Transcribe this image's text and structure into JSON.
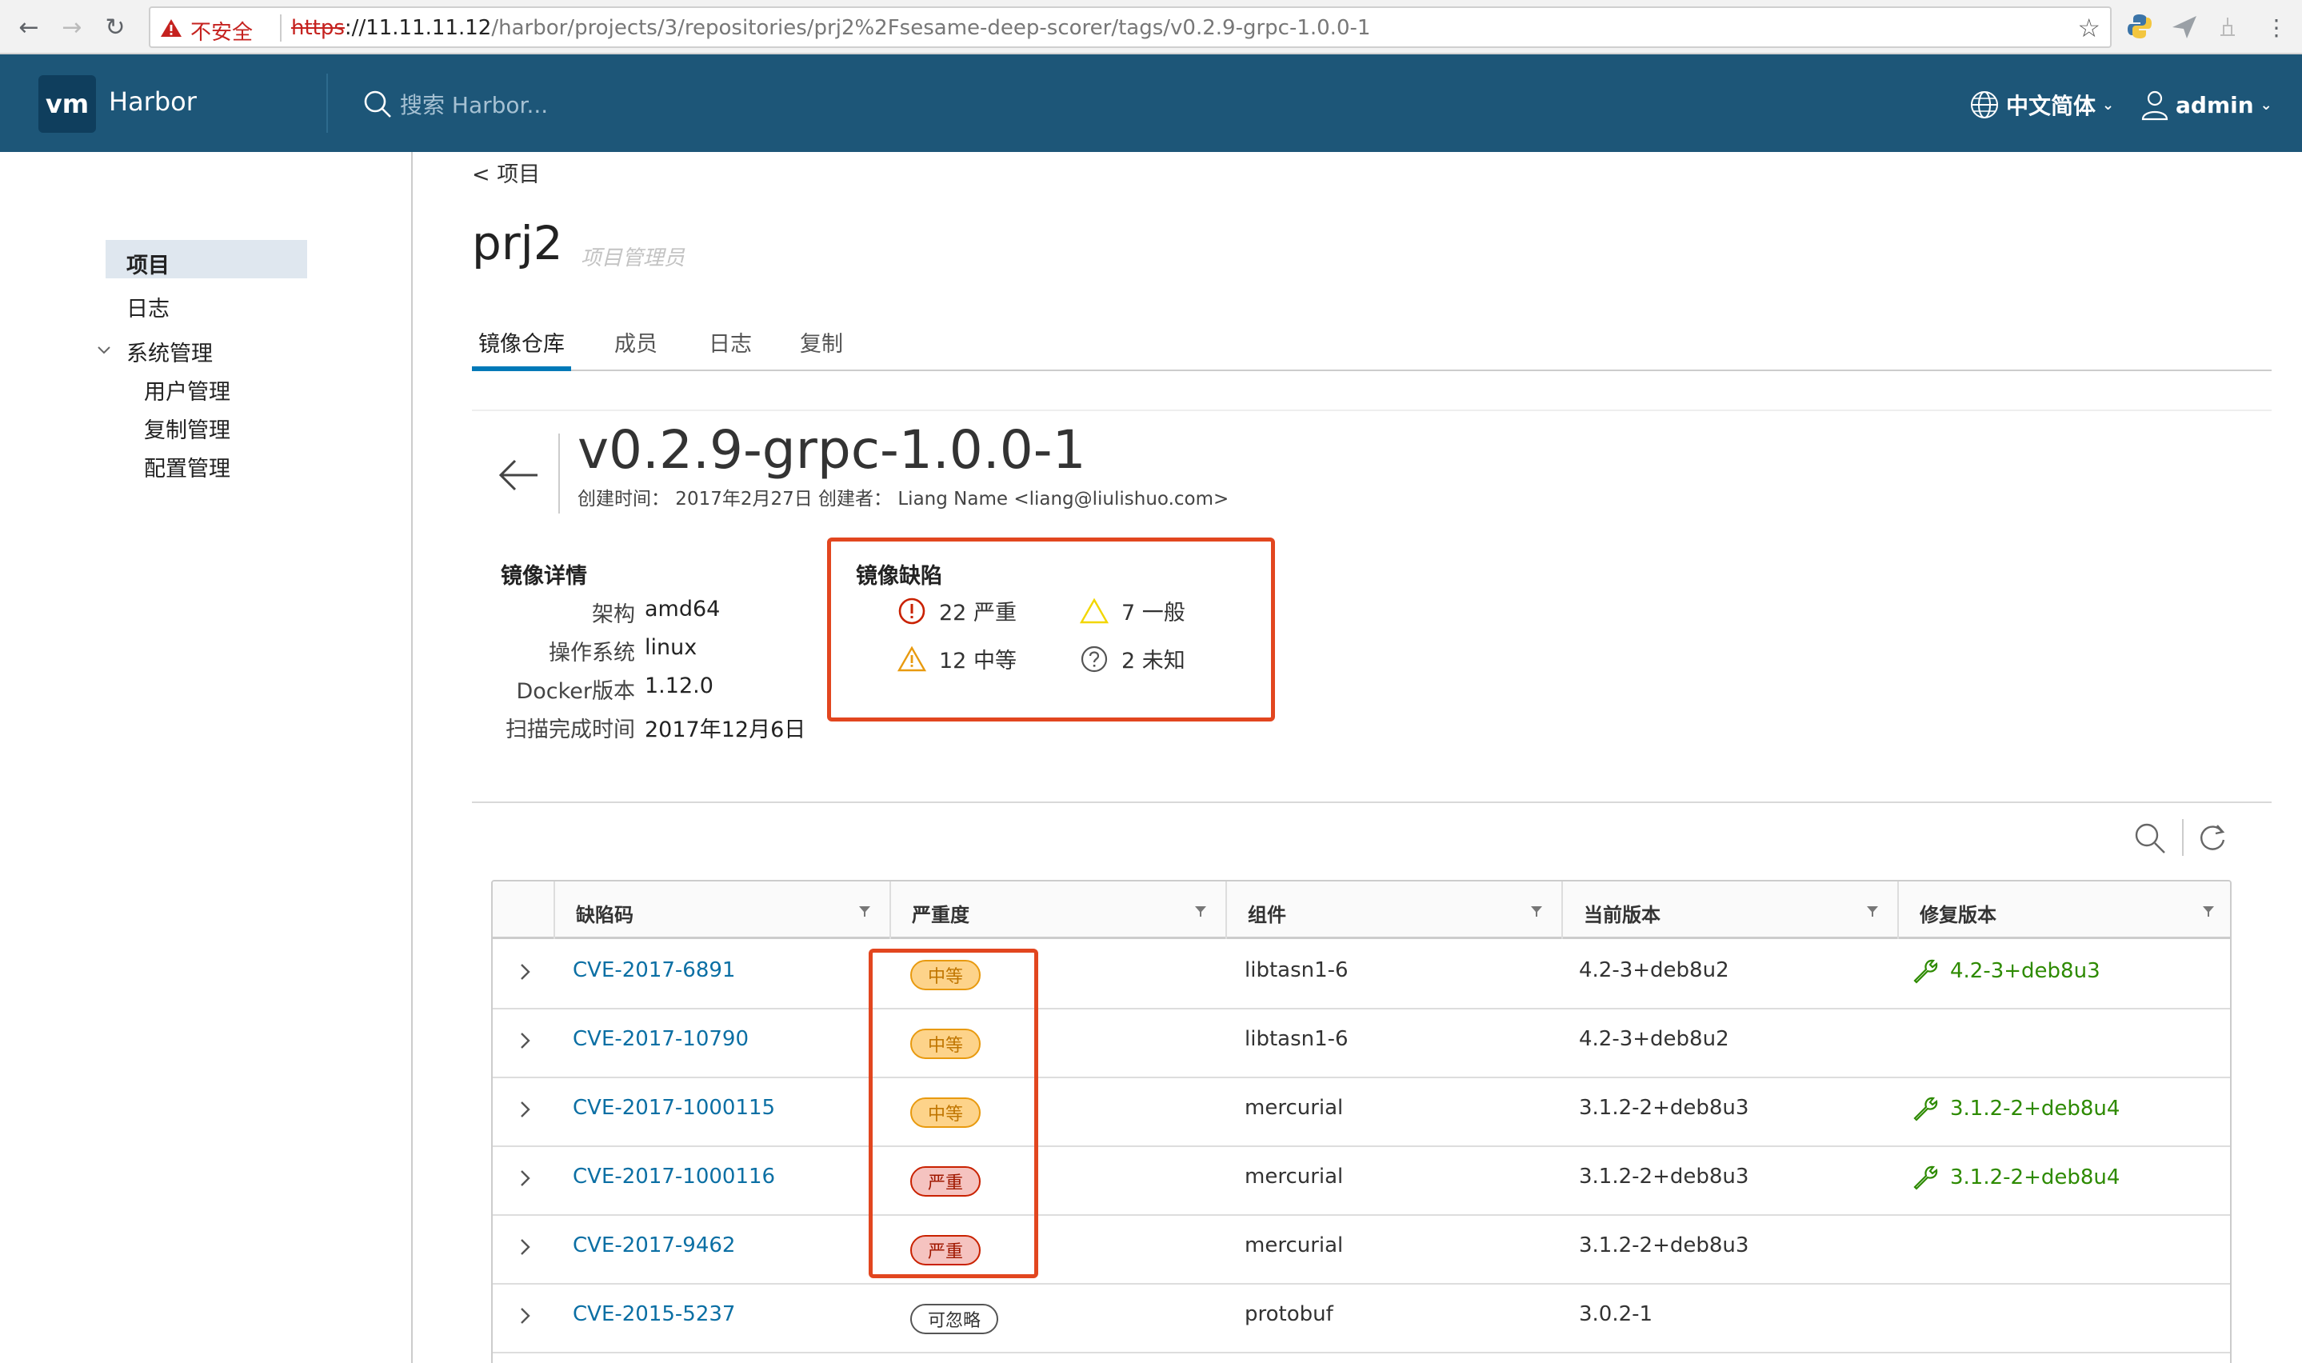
{
  "browser": {
    "not_secure": "不安全",
    "url_protocol": "https",
    "url_host": "://11.11.11.12",
    "url_path": "/harbor/projects/3/repositories/prj2%2Fsesame-deep-scorer/tags/v0.2.9-grpc-1.0.0-1"
  },
  "header": {
    "logo": "vm",
    "app_name": "Harbor",
    "search_placeholder": "搜索 Harbor...",
    "language": "中文简体",
    "user": "admin"
  },
  "sidebar": {
    "items": [
      {
        "label": "项目"
      },
      {
        "label": "日志"
      },
      {
        "label": "系统管理"
      }
    ],
    "admin_children": [
      {
        "label": "用户管理"
      },
      {
        "label": "复制管理"
      },
      {
        "label": "配置管理"
      }
    ]
  },
  "project": {
    "breadcrumb": "< 项目",
    "name": "prj2",
    "role": "项目管理员",
    "tabs": [
      "镜像仓库",
      "成员",
      "日志",
      "复制"
    ]
  },
  "tag": {
    "name": "v0.2.9-grpc-1.0.0-1",
    "created_line": "创建时间：  2017年2月27日 创建者：  Liang Name <liang@liulishuo.com>"
  },
  "image_details": {
    "title": "镜像详情",
    "rows": [
      {
        "key": "架构",
        "value": "amd64"
      },
      {
        "key": "操作系统",
        "value": "linux"
      },
      {
        "key": "Docker版本",
        "value": "1.12.0"
      },
      {
        "key": "扫描完成时间",
        "value": "2017年12月6日"
      }
    ]
  },
  "vulnerability_summary": {
    "title": "镜像缺陷",
    "critical": "22 严重",
    "low": "7 一般",
    "medium": "12 中等",
    "unknown": "2 未知",
    "colors": {
      "critical": "#c92100",
      "low": "#f2d600",
      "medium": "#e89a0f",
      "unknown": "#555555"
    }
  },
  "grid": {
    "columns": [
      "缺陷码",
      "严重度",
      "组件",
      "当前版本",
      "修复版本"
    ],
    "rows": [
      {
        "cve": "CVE-2017-6891",
        "severity": "中等",
        "severity_level": "medium",
        "package": "libtasn1-6",
        "version": "4.2-3+deb8u2",
        "fixed": "4.2-3+deb8u3"
      },
      {
        "cve": "CVE-2017-10790",
        "severity": "中等",
        "severity_level": "medium",
        "package": "libtasn1-6",
        "version": "4.2-3+deb8u2",
        "fixed": ""
      },
      {
        "cve": "CVE-2017-1000115",
        "severity": "中等",
        "severity_level": "medium",
        "package": "mercurial",
        "version": "3.1.2-2+deb8u3",
        "fixed": "3.1.2-2+deb8u4"
      },
      {
        "cve": "CVE-2017-1000116",
        "severity": "严重",
        "severity_level": "critical",
        "package": "mercurial",
        "version": "3.1.2-2+deb8u3",
        "fixed": "3.1.2-2+deb8u4"
      },
      {
        "cve": "CVE-2017-9462",
        "severity": "严重",
        "severity_level": "critical",
        "package": "mercurial",
        "version": "3.1.2-2+deb8u3",
        "fixed": ""
      },
      {
        "cve": "CVE-2015-5237",
        "severity": "可忽略",
        "severity_level": "negligible",
        "package": "protobuf",
        "version": "3.0.2-1",
        "fixed": ""
      }
    ]
  }
}
